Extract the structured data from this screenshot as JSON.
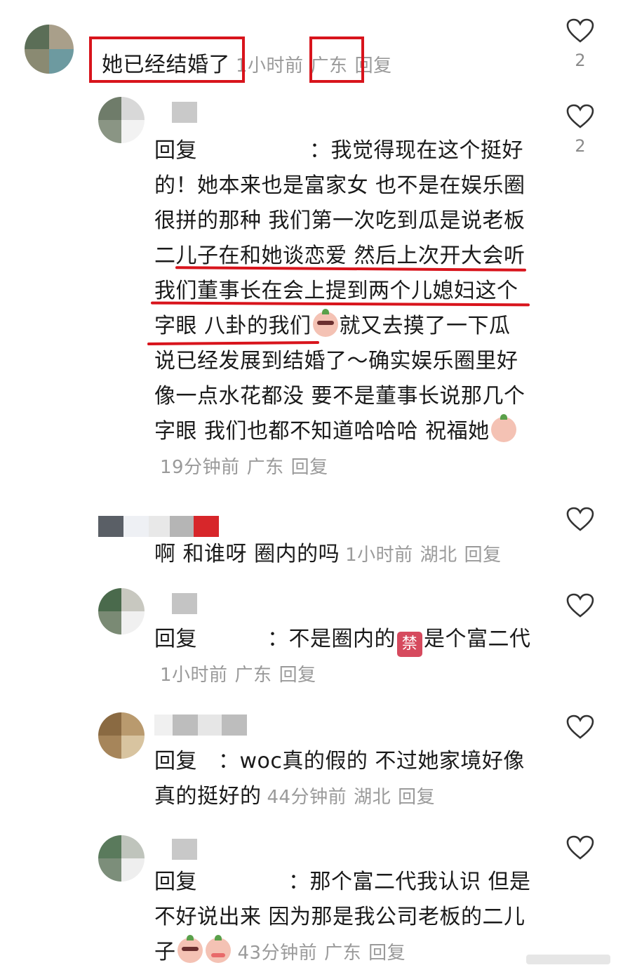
{
  "comments": [
    {
      "text": "她已经结婚了",
      "time": "1小时前",
      "location": "广东",
      "reply_label": "回复",
      "likes": "2"
    },
    {
      "prefix": "回复",
      "text": "：我觉得现在这个挺好的！她本来也是富家女 也不是在娱乐圈很拼的那种 我们第一次吃到瓜是说老板二儿子在和她谈恋爱 然后上次开大会听我们董事长在会上提到两个儿媳妇这个字眼 八卦的我们",
      "text2": "就又去摸了一下瓜 说已经发展到结婚了～确实娱乐圈里好像一点水花都没 要不是董事长说那几个字眼 我们也都不知道哈哈哈 祝福她",
      "time": "19分钟前",
      "location": "广东",
      "reply_label": "回复",
      "likes": "2"
    },
    {
      "text": "啊 和谁呀 圈内的吗",
      "time": "1小时前",
      "location": "湖北",
      "reply_label": "回复"
    },
    {
      "prefix": "回复",
      "text": "：不是圈内的",
      "ban": "禁",
      "text2": "是个富二代",
      "time": "1小时前",
      "location": "广东",
      "reply_label": "回复"
    },
    {
      "prefix": "回复",
      "text": "：woc真的假的 不过她家境好像真的挺好的",
      "time": "44分钟前",
      "location": "湖北",
      "reply_label": "回复"
    },
    {
      "prefix": "回复",
      "text": "：那个富二代我认识 但是不好说出来 因为那是我公司老板的二儿子",
      "time": "43分钟前",
      "location": "广东",
      "reply_label": "回复"
    }
  ],
  "colors": {
    "highlight": "#d8141c",
    "meta": "#9a9a9a"
  }
}
